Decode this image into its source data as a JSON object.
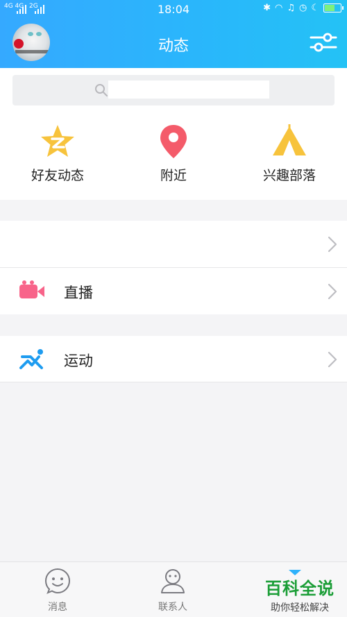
{
  "status_bar": {
    "network_label": "4G 4G",
    "network_label2": "2G",
    "time": "18:04"
  },
  "header": {
    "title": "动态",
    "avatar_caption": "",
    "settings_icon": "sliders-icon"
  },
  "search": {
    "placeholder": ""
  },
  "quick_actions": [
    {
      "label": "好友动态",
      "icon": "qzone-star-icon",
      "color": "#f7c33c"
    },
    {
      "label": "附近",
      "icon": "location-pin-icon",
      "color": "#f45b6a"
    },
    {
      "label": "兴趣部落",
      "icon": "tent-icon",
      "color": "#f7c33c"
    }
  ],
  "list": {
    "blank_row_label": "",
    "live": {
      "label": "直播",
      "icon": "video-camera-icon",
      "color": "#f8648a"
    },
    "sport": {
      "label": "运动",
      "icon": "running-icon",
      "color": "#1e9cf0"
    }
  },
  "tabs": [
    {
      "label": "消息",
      "icon": "smile-chat-icon"
    },
    {
      "label": "联系人",
      "icon": "contact-person-icon"
    }
  ],
  "watermark": {
    "title": "百科全说",
    "subtitle": "助你轻松解决"
  },
  "colors": {
    "header_start": "#35a9ff",
    "header_end": "#24c2f5"
  }
}
